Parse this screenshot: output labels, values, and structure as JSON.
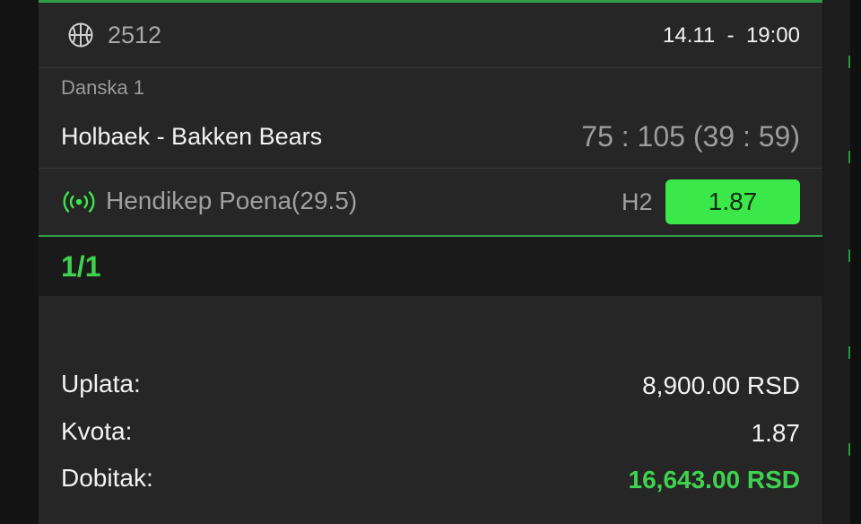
{
  "event": {
    "sport_icon": "basketball-icon",
    "code": "2512",
    "datetime": "14.11  -  19:00"
  },
  "match": {
    "league": "Danska 1",
    "name": "Holbaek - Bakken Bears",
    "score": "75 : 105 (39 : 59)"
  },
  "bet": {
    "live_icon": "live-signal-icon",
    "market": "Hendikep Poena(29.5)",
    "pick": "H2",
    "odd": "1.87"
  },
  "ticket": {
    "count": "1/1"
  },
  "summary": {
    "stake_label": "Uplata:",
    "stake_value": "8,900.00 RSD",
    "odds_label": "Kvota:",
    "odds_value": "1.87",
    "win_label": "Dobitak:",
    "win_value": "16,643.00 RSD"
  },
  "colors": {
    "accent_green": "#3be84a",
    "win_text": "#3fd24f",
    "card_bg": "#262626",
    "page_bg": "#161616"
  }
}
